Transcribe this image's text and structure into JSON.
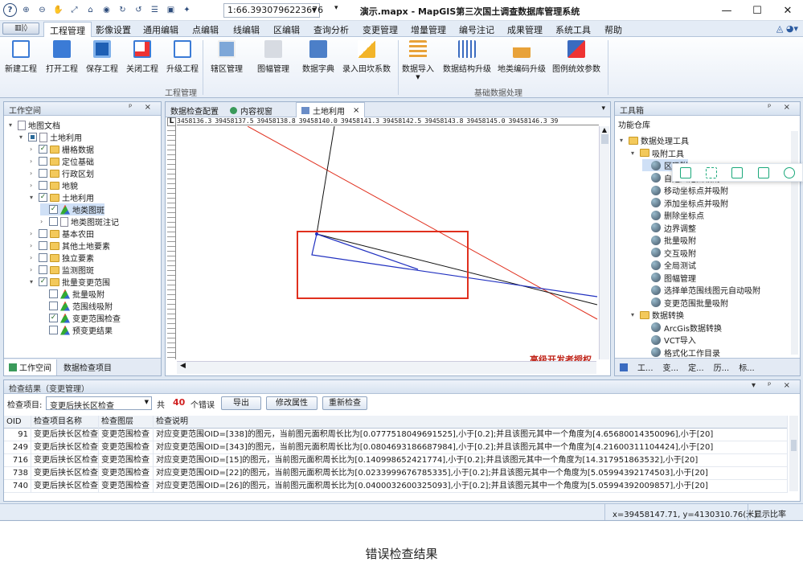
{
  "window": {
    "title": "演示.mapx - MapGIS第三次国土调查数据库管理系统",
    "scale": "1:66.3930796223676"
  },
  "ribbon_tabs": [
    "工程管理",
    "影像设置",
    "通用编辑",
    "点编辑",
    "线编辑",
    "区编辑",
    "查询分析",
    "变更管理",
    "增量管理",
    "编号注记",
    "成果管理",
    "系统工具",
    "帮助"
  ],
  "ribbon": {
    "buttons": [
      "新建工程",
      "打开工程",
      "保存工程",
      "关闭工程",
      "升级工程",
      "辖区管理",
      "图幅管理",
      "数据字典",
      "录入田坎系数",
      "数据导入",
      "数据结构升级",
      "地类编码升级",
      "图例统效参数"
    ],
    "groups": [
      "工程管理",
      "基础数据处理"
    ]
  },
  "workspace": {
    "title": "工作空间",
    "tree": [
      {
        "label": "地图文档",
        "level": 0,
        "type": "doc"
      },
      {
        "label": "土地利用",
        "level": 1,
        "type": "map"
      },
      {
        "label": "栅格数据",
        "level": 2,
        "type": "folder",
        "checked": true
      },
      {
        "label": "定位基础",
        "level": 2,
        "type": "folder"
      },
      {
        "label": "行政区划",
        "level": 2,
        "type": "folder"
      },
      {
        "label": "地貌",
        "level": 2,
        "type": "folder"
      },
      {
        "label": "土地利用",
        "level": 2,
        "type": "folder",
        "checked": true,
        "open": true
      },
      {
        "label": "地类图斑",
        "level": 3,
        "type": "layer",
        "checked": true,
        "selected": true
      },
      {
        "label": "地类图斑注记",
        "level": 3,
        "type": "doc"
      },
      {
        "label": "基本农田",
        "level": 2,
        "type": "folder"
      },
      {
        "label": "其他土地要素",
        "level": 2,
        "type": "folder"
      },
      {
        "label": "独立要素",
        "level": 2,
        "type": "folder"
      },
      {
        "label": "监测图斑",
        "level": 2,
        "type": "folder"
      },
      {
        "label": "批量变更范围",
        "level": 2,
        "type": "folder",
        "checked": true,
        "open": true
      },
      {
        "label": "批量吸附",
        "level": 3,
        "type": "layer"
      },
      {
        "label": "范围线吸附",
        "level": 3,
        "type": "layer"
      },
      {
        "label": "变更范围检查",
        "level": 3,
        "type": "layer",
        "checked": true
      },
      {
        "label": "预变更结果",
        "level": 3,
        "type": "layer"
      }
    ],
    "bottom_tabs": [
      "工作空间",
      "数据检查项目"
    ]
  },
  "map_tabs": [
    "数据检查配置",
    "内容视窗",
    "土地利用"
  ],
  "map": {
    "ruler_ticks": [
      "3458136.3",
      "39458137.5",
      "39458138.8",
      "39458140.0",
      "39458141.3",
      "39458142.5",
      "39458143.8",
      "39458145.0",
      "39458146.3",
      "39"
    ],
    "watermark": "高级开发者授权"
  },
  "toolbox": {
    "title": "工具箱",
    "root": "功能仓库",
    "items": [
      {
        "label": "数据处理工具",
        "level": 0,
        "kind": "folder"
      },
      {
        "label": "吸附工具",
        "level": 1,
        "kind": "folder"
      },
      {
        "label": "区吸附",
        "level": 2,
        "kind": "tool"
      },
      {
        "label": "自定义范围吸附",
        "level": 2,
        "kind": "tool"
      },
      {
        "label": "移动坐标点并吸附",
        "level": 2,
        "kind": "tool"
      },
      {
        "label": "添加坐标点并吸附",
        "level": 2,
        "kind": "tool"
      },
      {
        "label": "删除坐标点",
        "level": 2,
        "kind": "tool"
      },
      {
        "label": "边界调整",
        "level": 2,
        "kind": "tool"
      },
      {
        "label": "批量吸附",
        "level": 2,
        "kind": "tool"
      },
      {
        "label": "交互吸附",
        "level": 2,
        "kind": "tool"
      },
      {
        "label": "全局测试",
        "level": 2,
        "kind": "tool"
      },
      {
        "label": "图幅管理",
        "level": 2,
        "kind": "tool"
      },
      {
        "label": "选择单范围线图元自动吸附",
        "level": 2,
        "kind": "tool"
      },
      {
        "label": "变更范围批量吸附",
        "level": 2,
        "kind": "tool"
      },
      {
        "label": "数据转换",
        "level": 1,
        "kind": "folder"
      },
      {
        "label": "ArcGis数据转换",
        "level": 2,
        "kind": "tool"
      },
      {
        "label": "VCT导入",
        "level": 2,
        "kind": "tool"
      },
      {
        "label": "格式化工作目录",
        "level": 2,
        "kind": "tool"
      }
    ],
    "bottom_tabs": [
      "工...",
      "变...",
      "定...",
      "历...",
      "标..."
    ]
  },
  "results": {
    "title": "检查结果（变更管理）",
    "item_label": "检查项目:",
    "item_value": "变更后挟长区检查",
    "count_prefix": "共",
    "count": "40",
    "count_suffix": "个错误",
    "buttons": [
      "导出",
      "修改属性",
      "重新检查"
    ],
    "columns": [
      "OID",
      "检查项目名称",
      "检查图层",
      "检查说明"
    ],
    "rows": [
      [
        "91",
        "变更后挟长区检查",
        "变更范围检查",
        "对应变更范围OID=[338]的图元，当前图元面积周长比为[0.0777518049691525],小于[0.2];并且该图元其中一个角度为[4.65680014350096],小于[20]"
      ],
      [
        "249",
        "变更后挟长区检查",
        "变更范围检查",
        "对应变更范围OID=[343]的图元，当前图元面积周长比为[0.0804693186687984],小于[0.2];并且该图元其中一个角度为[4.21600311104424],小于[20]"
      ],
      [
        "716",
        "变更后挟长区检查",
        "变更范围检查",
        "对应变更范围OID=[15]的图元，当前图元面积周长比为[0.140998652421774],小于[0.2];并且该图元其中一个角度为[14.317951863532],小于[20]"
      ],
      [
        "738",
        "变更后挟长区检查",
        "变更范围检查",
        "对应变更范围OID=[22]的图元，当前图元面积周长比为[0.0233999676785335],小于[0.2];并且该图元其中一个角度为[5.05994392174503],小于[20]"
      ],
      [
        "740",
        "变更后挟长区检查",
        "变更范围检查",
        "对应变更范围OID=[26]的图元，当前图元面积周长比为[0.0400032600325093],小于[0.2];并且该图元其中一个角度为[5.05994392009857],小于[20]"
      ]
    ]
  },
  "status": {
    "coords": "x=39458147.71, y=4130310.76(米)",
    "ratio": "显示比率"
  },
  "caption": "错误检查结果",
  "colors": {
    "accent": "#2a5aa0",
    "selection_box": "#e0301e",
    "line_red": "#e0301e",
    "line_blue": "#2030c0"
  }
}
